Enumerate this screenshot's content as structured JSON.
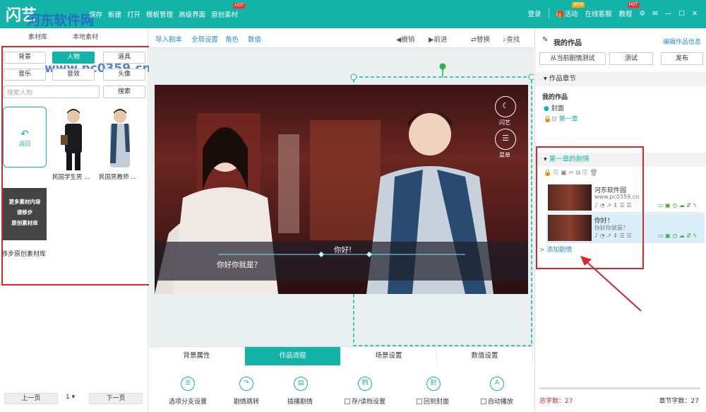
{
  "app": {
    "logo": "闪艺",
    "watermark": "河东软件网",
    "watermark_url": "www.pc0359.cn"
  },
  "topmenu": [
    {
      "label": "保存"
    },
    {
      "label": "新建"
    },
    {
      "label": "打开"
    },
    {
      "label": "模板管理"
    },
    {
      "label": "高级界面"
    },
    {
      "label": "原创素材",
      "badge": "HOT"
    }
  ],
  "topright": {
    "login": "登录",
    "activity": "活动",
    "activity_badge": "NEW",
    "service": "在线客服",
    "tutorial": "教程",
    "tutorial_badge": "HOT"
  },
  "left": {
    "tabs": [
      "素材库",
      "本地素材"
    ],
    "categories": [
      "背景",
      "人物",
      "道具",
      "音乐",
      "音效",
      "头像"
    ],
    "active_category": "人物",
    "search_placeholder": "搜索人物",
    "search_btn": "搜索",
    "back": "返回",
    "characters": [
      "民国学生男 ...",
      "民国男教师 ..."
    ],
    "promo": [
      "更多素材内容",
      "请移步",
      "原创素材库"
    ],
    "promo_link": "移步原创素材库",
    "prev": "上一页",
    "page": "1",
    "next": "下一页"
  },
  "toolbar": {
    "left": [
      "导入剧本",
      "全局设置",
      "角色",
      "数值"
    ],
    "undo": "撤销",
    "redo": "前进",
    "replace": "替换",
    "find": "查找"
  },
  "stage": {
    "speaker": "你好!",
    "dialog": "你好你就是？",
    "menu_a": "闪艺",
    "menu_b": "菜单"
  },
  "bottom": {
    "tabs": [
      "背景属性",
      "作品流程",
      "场景设置",
      "数值设置"
    ],
    "active_tab": "作品流程",
    "actions": [
      "选项分支设置",
      "剧情跳转",
      "插播剧情",
      "存/读档设置",
      "回到封面",
      "自动播放"
    ]
  },
  "right": {
    "title": "我的作品",
    "edit_link": "编辑作品信息",
    "btn_test_from": "从当前剧情测试",
    "btn_test": "测试",
    "btn_publish": "发布",
    "chapters_header": "作品章节",
    "work_name": "我的作品",
    "cover": "封面",
    "chapter1": "第一章",
    "plot_header": "第一章的剧情",
    "stories": [
      {
        "title": "河东软件园",
        "sub": "www.pc0359.cn"
      },
      {
        "title": "你好！",
        "sub": "你好你就是？"
      }
    ],
    "add_story": "添加剧情",
    "total_chars_label": "总字数：27",
    "chapter_chars_label": "章节字数：27"
  },
  "colors": {
    "accent": "#13b3a8",
    "annotation": "#d9262c",
    "link": "#2a8fd6"
  }
}
